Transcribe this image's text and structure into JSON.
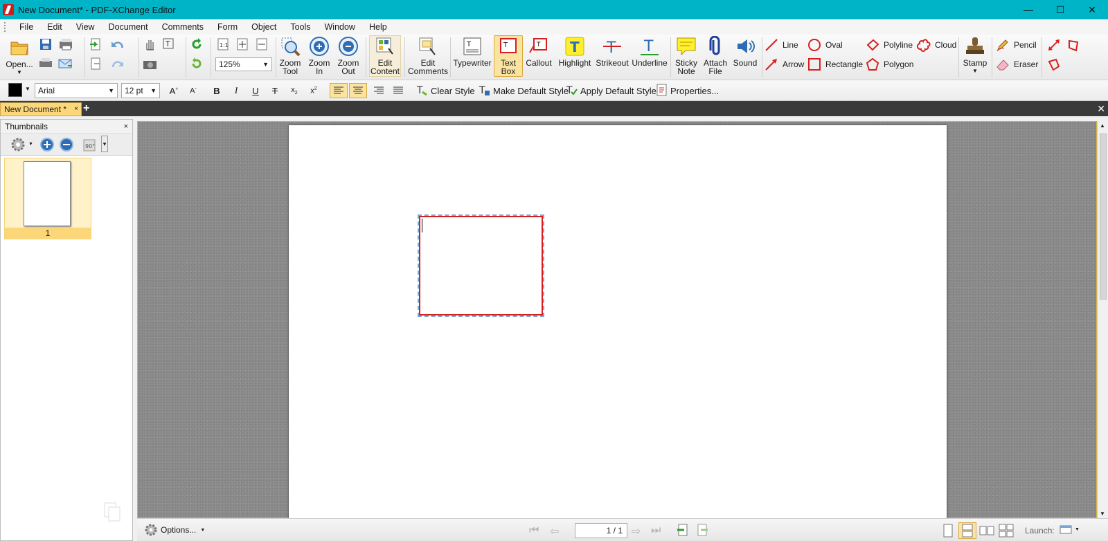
{
  "window": {
    "title": "New Document* - PDF-XChange Editor",
    "minimize": "—",
    "maximize": "☐",
    "close": "✕"
  },
  "menu": [
    "File",
    "Edit",
    "View",
    "Document",
    "Comments",
    "Form",
    "Object",
    "Tools",
    "Window",
    "Help"
  ],
  "toolbar": {
    "open": "Open...",
    "zoom_value": "125%",
    "zoom_tool": [
      "Zoom",
      "Tool"
    ],
    "zoom_in": [
      "Zoom",
      "In"
    ],
    "zoom_out": [
      "Zoom",
      "Out"
    ],
    "edit_content": [
      "Edit",
      "Content"
    ],
    "edit_comments": [
      "Edit",
      "Comments"
    ],
    "typewriter": "Typewriter",
    "text_box": [
      "Text",
      "Box"
    ],
    "callout": "Callout",
    "highlight": "Highlight",
    "strikeout": "Strikeout",
    "underline": "Underline",
    "sticky_note": [
      "Sticky",
      "Note"
    ],
    "attach_file": [
      "Attach",
      "File"
    ],
    "sound": "Sound",
    "line": "Line",
    "arrow": "Arrow",
    "oval": "Oval",
    "rectangle": "Rectangle",
    "polyline": "Polyline",
    "polygon": "Polygon",
    "cloud": "Cloud",
    "stamp": "Stamp",
    "pencil": "Pencil",
    "eraser": "Eraser"
  },
  "format": {
    "font": "Arial",
    "size": "12 pt",
    "bold": "B",
    "italic": "I",
    "underline": "U",
    "strike": "T",
    "clear_style": "Clear Style",
    "make_default": "Make Default Style",
    "apply_default": "Apply Default Style",
    "properties": "Properties...",
    "text_color": "#000000"
  },
  "tabs": {
    "doc_tab": "New Document *",
    "close": "×",
    "add": "+",
    "close_all": "✕"
  },
  "thumbnails": {
    "title": "Thumbnails",
    "close": "×",
    "page_number": "1"
  },
  "status": {
    "options": "Options...",
    "page_indicator": "1 / 1",
    "launch": "Launch:"
  },
  "colors": {
    "titlebar": "#00b4c8",
    "active": "#fbe3a1",
    "textbox_border": "#d62020"
  }
}
